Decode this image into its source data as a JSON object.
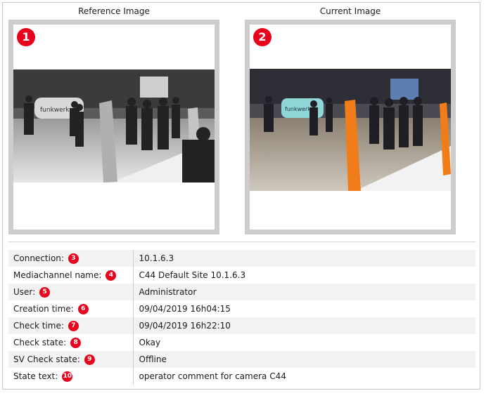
{
  "reference": {
    "title": "Reference Image",
    "badge": "1"
  },
  "current": {
    "title": "Current Image",
    "badge": "2"
  },
  "colors": {
    "badge": "#e8001c",
    "frame": "#cdcdcd",
    "orange": "#f07d1a"
  },
  "rows": [
    {
      "label": "Connection:",
      "badge": "3",
      "value": "10.1.6.3"
    },
    {
      "label": "Mediachannel name:",
      "badge": "4",
      "value": "C44 Default Site 10.1.6.3"
    },
    {
      "label": "User:",
      "badge": "5",
      "value": "Administrator"
    },
    {
      "label": "Creation time:",
      "badge": "6",
      "value": "09/04/2019 16h04:15"
    },
    {
      "label": "Check time:",
      "badge": "7",
      "value": "09/04/2019 16h22:10"
    },
    {
      "label": "Check state:",
      "badge": "8",
      "value": "Okay"
    },
    {
      "label": "SV Check state:",
      "badge": "9",
      "value": "Offline"
    },
    {
      "label": "State text:",
      "badge": "10",
      "value": "operator comment for camera C44"
    }
  ]
}
